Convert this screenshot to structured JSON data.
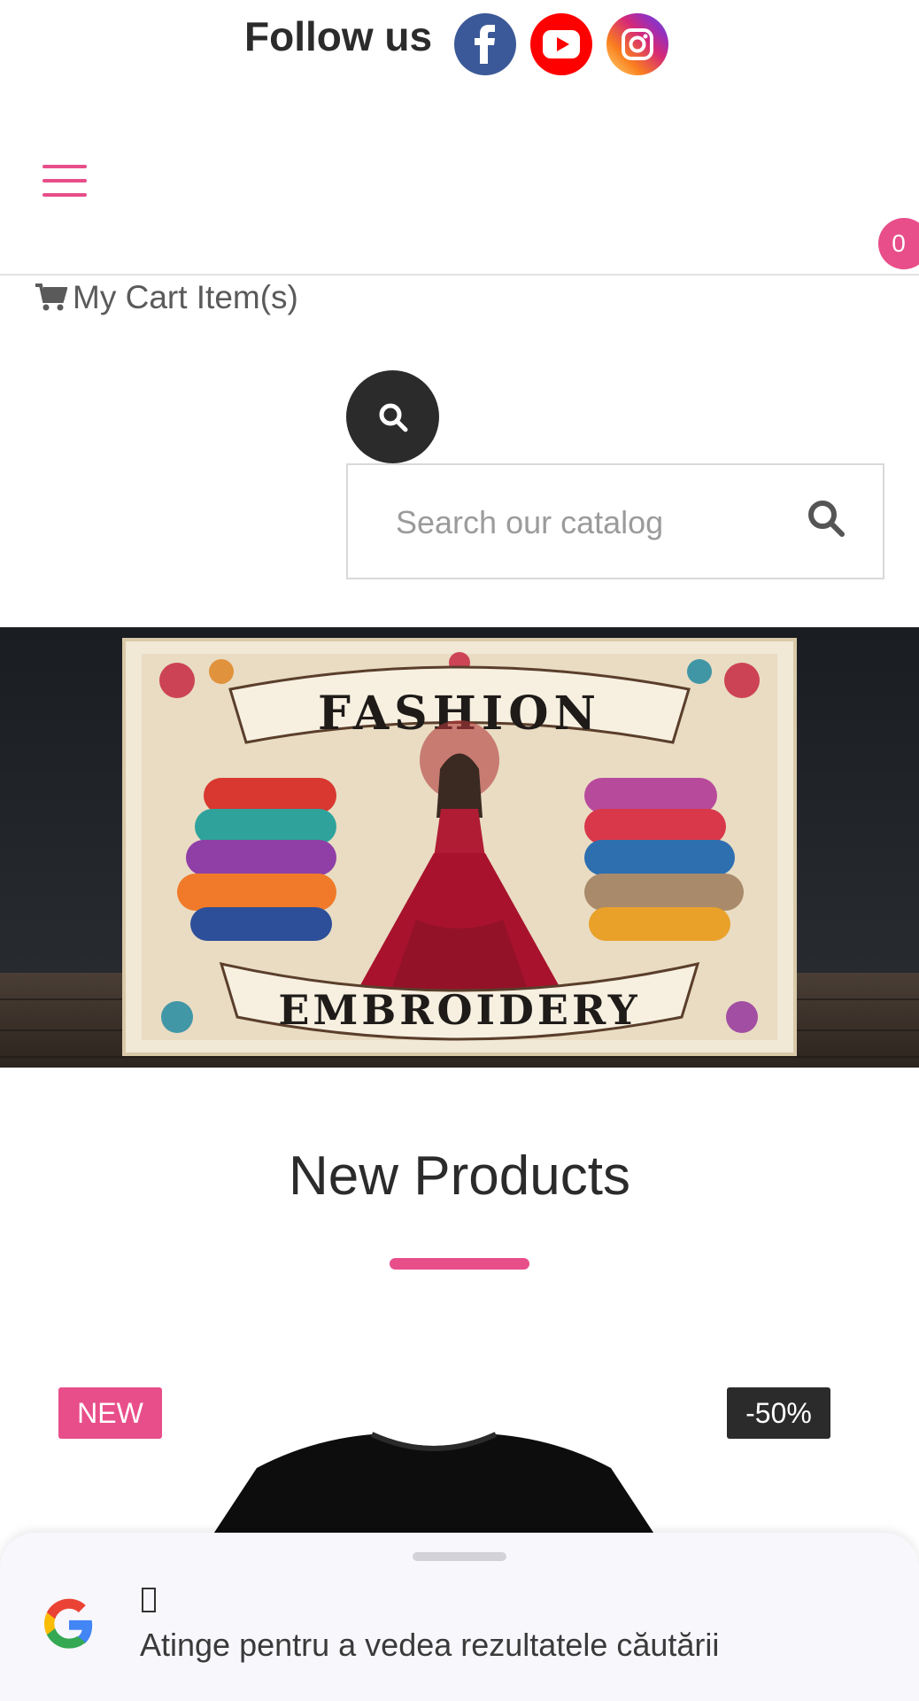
{
  "follow": {
    "label": "Follow us",
    "socials": [
      {
        "name": "facebook-icon",
        "color": "#3b5998"
      },
      {
        "name": "youtube-icon",
        "color": "#ff0000"
      },
      {
        "name": "instagram-icon",
        "color": "#d62976"
      }
    ]
  },
  "header": {
    "menu_icon": "hamburger-icon",
    "cart_count": "0",
    "cart_label": "My Cart Item(s)",
    "accent_color": "#e84e8a"
  },
  "search": {
    "placeholder": "Search our catalog",
    "toggle_icon": "search-icon"
  },
  "banner": {
    "top_text": "FASHION",
    "bottom_text": "EMBROIDERY"
  },
  "new_products": {
    "title": "New Products",
    "badges": {
      "new": "NEW",
      "discount": "-50%"
    }
  },
  "bottom_sheet": {
    "glyph": "",
    "text": "Atinge pentru a vedea rezultatele căutării"
  }
}
